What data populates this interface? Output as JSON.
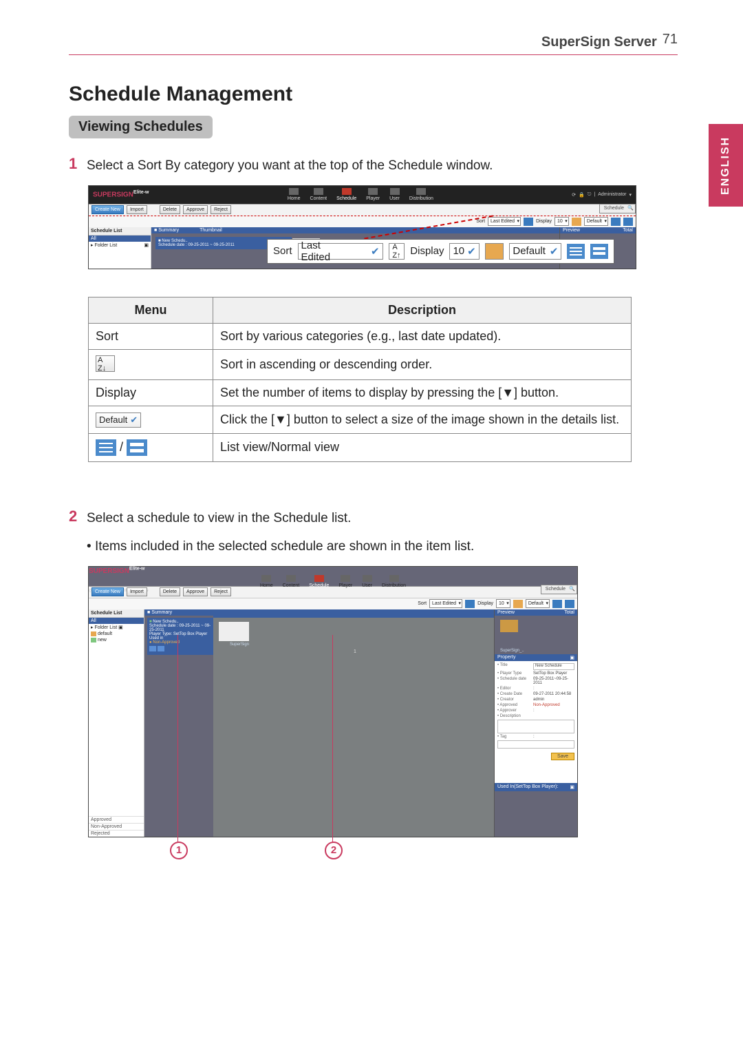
{
  "header": {
    "product": "SuperSign Server",
    "page_number": "71"
  },
  "language_tab": "ENGLISH",
  "h1": "Schedule Management",
  "section": "Viewing Schedules",
  "step1": {
    "num": "1",
    "text": "Select a Sort By category you want at the top of the Schedule window."
  },
  "step2": {
    "num": "2",
    "text": "Select a schedule to view in the Schedule list.",
    "bullet": "Items included in the selected schedule are shown in the item list."
  },
  "app": {
    "brand": "SUPERSIGN",
    "brand_sup": "Elite-w",
    "nav": {
      "home": "Home",
      "content": "Content",
      "schedule": "Schedule",
      "player": "Player",
      "user": "User",
      "distribution": "Distribution"
    },
    "account": "Administrator",
    "search_placeholder": "Schedule",
    "toolbar": {
      "create_new": "Create New",
      "import": "Import",
      "delete": "Delete",
      "approve": "Approve",
      "reject": "Reject"
    },
    "sortbar": {
      "sort_label": "Sort",
      "sort_value": "Last Edited",
      "display_label": "Display",
      "display_value": "10",
      "default_label": "Default"
    },
    "sidebar": {
      "title": "Schedule List",
      "all": "All",
      "folder_list": "▸ Folder List",
      "default": "default",
      "new": "new",
      "status_approved": "Approved",
      "status_non_approved": "Non-Approved",
      "status_rejected": "Rejected"
    },
    "summary": {
      "label": "Summary",
      "thumb": "Thumbnail"
    },
    "card": {
      "title": "New Schedu..",
      "schedule_date": "Schedule date : 09-25-2011 ~ 09-25-2011",
      "player_type": "Player Type: SetTop Box Player",
      "used_in": "Used in",
      "status_dot": "Non-Approved",
      "item_name": "SuperSign"
    },
    "preview": {
      "title": "Preview",
      "total": "Total",
      "caption": "SuperSign_.."
    },
    "property": {
      "title": "Property",
      "rows": {
        "title_k": "• Title",
        "title_v": "New Schedule",
        "player_type_k": "• Player Type",
        "player_type_v": "SetTop Box Player",
        "schedule_date_k": "• Schedule date",
        "schedule_date_v": "09-25-2011~09-25-2011",
        "editor_k": "• Editor",
        "editor_v": ":",
        "create_date_k": "• Create Date",
        "create_date_v": "09-27-2011 20:44:58",
        "creator_k": "• Creator",
        "creator_v": "admin",
        "approved_k": "• Approved",
        "approved_v": "Non-Approved",
        "approver_k": "• Approver",
        "approver_v": ":",
        "description_k": "• Description",
        "tag_k": "• Tag",
        "tag_v": ":"
      },
      "save": "Save"
    },
    "footer": {
      "used_in": "Used In(SetTop Box Player):"
    },
    "item_list_count": "1"
  },
  "callout": {
    "sort": "Sort",
    "sort_value": "Last Edited",
    "display": "Display",
    "display_value": "10",
    "default": "Default"
  },
  "table": {
    "head_menu": "Menu",
    "head_desc": "Description",
    "rows": [
      {
        "menu_text": "Sort",
        "desc": "Sort by various categories (e.g., last date updated)."
      },
      {
        "menu_icon": "az",
        "desc": "Sort in ascending or descending order."
      },
      {
        "menu_text": "Display",
        "desc": "Set the number of items to display by pressing the [▼] button."
      },
      {
        "menu_icon": "default",
        "desc": "Click the [▼] button to select a size of the image shown in the details list."
      },
      {
        "menu_icon": "views",
        "desc": "List view/Normal view"
      }
    ],
    "default_icon_label": "Default"
  },
  "annotations": {
    "circ1": "1",
    "circ2": "2"
  }
}
